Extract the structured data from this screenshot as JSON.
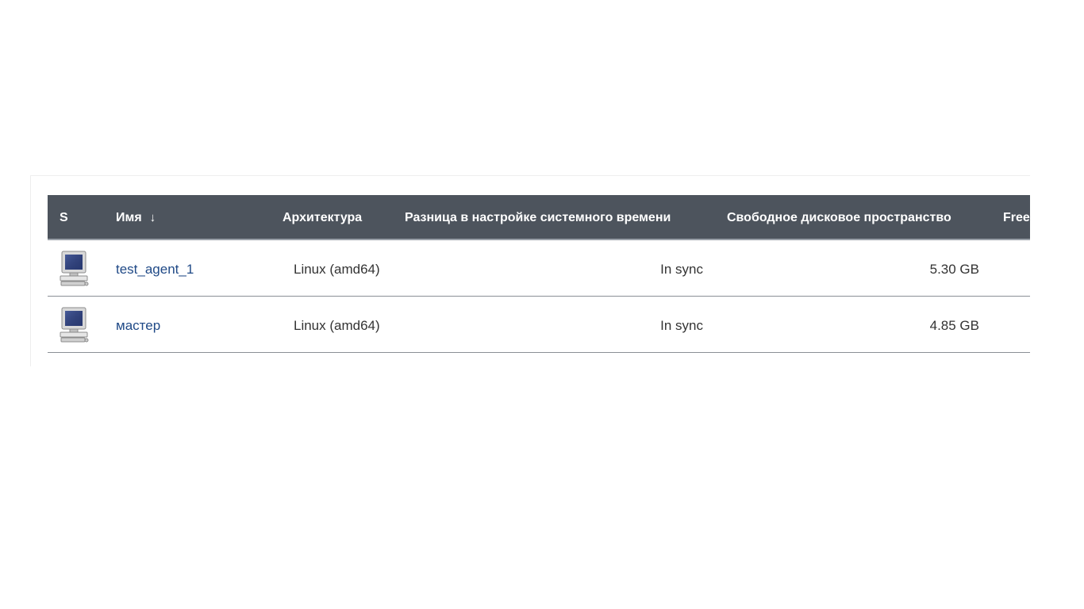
{
  "table": {
    "headers": {
      "status": "S",
      "name": "Имя",
      "name_sort_indicator": "↓",
      "architecture": "Архитектура",
      "clock_diff": "Разница в настройке системного времени",
      "free_disk": "Свободное дисковое пространство",
      "free_next": "Free"
    },
    "rows": [
      {
        "status_icon": "computer-icon",
        "name": "test_agent_1",
        "architecture": "Linux (amd64)",
        "clock_diff": "In sync",
        "free_disk": "5.30 GB"
      },
      {
        "status_icon": "computer-icon",
        "name": "мастер",
        "architecture": "Linux (amd64)",
        "clock_diff": "In sync",
        "free_disk": "4.85 GB"
      }
    ]
  },
  "colors": {
    "header_bg": "#4d545d",
    "link": "#204a87",
    "text": "#333333"
  }
}
